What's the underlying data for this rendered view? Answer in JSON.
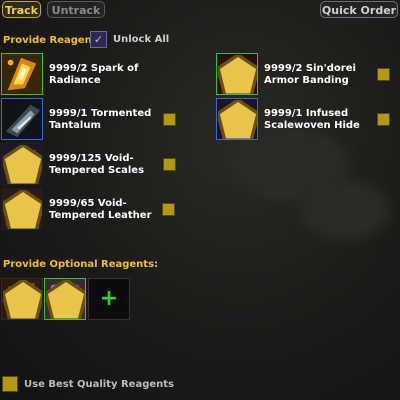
{
  "toolbar": {
    "track_label": "Track",
    "untrack_label": "Untrack",
    "quick_order_label": "Quick Order"
  },
  "reagents_section": {
    "title": "Provide Reagents:",
    "unlock_all_label": "Unlock All"
  },
  "reagents": [
    {
      "line1": "9999/2 Spark of",
      "line2": "Radiance",
      "icon": "spark-of-radiance-icon",
      "quality": false,
      "border": "green"
    },
    {
      "line1": "9999/1 Tormented",
      "line2": "Tantalum",
      "icon": "tormented-tantalum-icon",
      "quality": false,
      "border": "blue"
    },
    {
      "line1": "9999/125 Void-",
      "line2": "Tempered Scales",
      "icon": "void-tempered-scales-icon",
      "quality": true,
      "border": "none"
    },
    {
      "line1": "9999/65 Void-",
      "line2": "Tempered Leather",
      "icon": "void-tempered-leather-icon",
      "quality": true,
      "border": "none"
    },
    {
      "line1": "9999/2 Sin'dorei",
      "line2": "Armor Banding",
      "icon": "sindorei-armor-banding-icon",
      "quality": true,
      "border": "green"
    },
    {
      "line1": "9999/1 Infused",
      "line2": "Scalewoven Hide",
      "icon": "infused-scalewoven-hide-icon",
      "quality": true,
      "border": "blue"
    }
  ],
  "optional_section": {
    "title": "Provide Optional Reagents:",
    "slots": [
      "optional-reagent-1-icon",
      "optional-reagent-2-icon"
    ],
    "add_symbol": "+"
  },
  "footer": {
    "best_quality_label": "Use Best Quality Reagents"
  },
  "colors": {
    "accent_gold": "#f2c21a",
    "checkbox_gold": "#b69712",
    "border_green": "#38c038",
    "border_blue": "#3a6ad6",
    "add_green": "#2ad62a"
  }
}
